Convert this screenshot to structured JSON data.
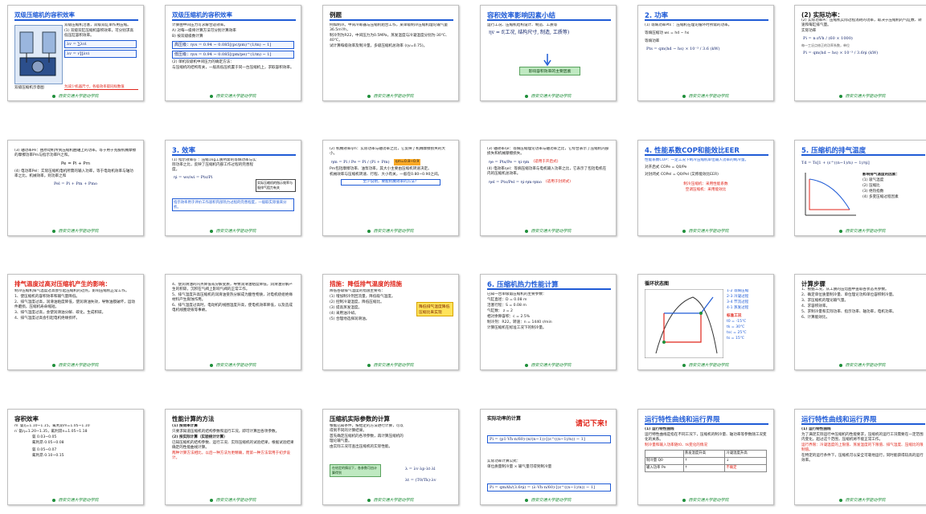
{
  "footer_text": "西安交通大学能动学院",
  "slides": [
    {
      "title": "双级压缩机的容积效率",
      "lines": [
        "双级压缩机活塞，双级双缸单作用压缩。",
        "(1) 双级双缸压缩机容积效率，可分别求高低压缸容积效率。",
        "双级压缩机示意图"
      ],
      "formula_a": "λv = ∑λvi",
      "formula_b": "λv = √∏λvi",
      "note": "为减少机器尺寸，各级效率取同样数值"
    },
    {
      "title": "双级压缩机的容积效率",
      "lines": [
        "计算由中间压力可求解合适效率。",
        "A) 对每一级将计算方法可分别计算效率",
        "B) 按双级级数计算"
      ],
      "formula_a": "高压级：ηvs = 0.94 − 0.085[(pc/pm)^(1/m) − 1]",
      "formula_b": "低压级：ηvs = 0.94 − 0.085[(pm/pe)^(1/m) − 1]",
      "lines2": [
        "(2) 单机双级机中间压力的确定方法：",
        "与压缩机的结构有关，一般高低压机置于同一台压缩机上，求取容积效率。"
      ]
    },
    {
      "title": "例题",
      "lines": [
        "例如制冷。中间冷却器与压缩机组合工作，某单级制冷压缩机理论输气量36.5m³/h，",
        "制冷剂为R22，中间压力为0.5MPa，蒸发温度与冷凝温度分别为-30℃、40℃，",
        "试计算每级效率及制冷量，多级压缩机总效率 (ηv=0.75)。"
      ]
    },
    {
      "title": "容积效率影响因素小结",
      "lines": [
        "运行工况、压缩机结构设计、制造、工质等"
      ],
      "formula_a": "ηv = f(工况, 结构尺寸, 制造, 工质等)",
      "note": "影响容积效率的主要因素"
    },
    {
      "title": "2. 功率",
      "lines": [
        "(1) 等熵功率Pts ：压缩机在理论循环时所需的功率。",
        "等熵压缩功 ws = hd − hs",
        "等熵功率"
      ],
      "formula_a": "Pts = qm(hd − hs) × 10⁻³ / 3.6  (kW)"
    },
    {
      "title": "(2) 实际功率：",
      "lines": [
        "(2) 实际功率Pi：压缩机实际过程消耗的功率，取决于压缩机的气缸数、转速和每缸排气量。",
        "实际功率",
        "每一工况点修正的功率系数，单位"
      ],
      "formula_a": "Pi = n·zVh / (60 × 1000)",
      "formula_b": "Pi = qm(hd − hs) × 10⁻³ / 3.6ηi  (kW)"
    },
    {
      "title": "(3) 轴功率",
      "lines": [
        "(3) 轴功率Pe：由原动机传到压缩机曲轴上的功率。等于用于克服机械摩擦的摩擦功率Pm与指示功率Pi之和。",
        "Pe = Pi + Pm",
        "(4) 电功率Pel：实际压缩机电机所需的输入功率，等于电动机效率与轴功率之比，机械效率，则功率之和"
      ],
      "formula_a": "Pel = Pi + Pm + Pmo"
    },
    {
      "title": "3. 效率",
      "lines": [
        "(1) 指示效率ηi ：压缩1kg工质所需的等熵功率与实际功率之比，反映了压缩机内部工作过程的完善程度。",
        "ηi = ws/wi = Pts/Pi",
        "指示效率用于评价工作容积内部热力过程的完善程度，一般取实际值来分析。"
      ],
      "note": "实际压缩机的指示效率与吸排气阻力有关"
    },
    {
      "title": "(2) 机械效率ηm：",
      "lines": [
        "(2) 机械效率ηm：实际功率与轴功率之比，它反映了机械摩擦损失的大小。"
      ],
      "formula_a": "ηm = Pi / Pe = Pi / (Pi + Pm)",
      "note": "ηm=0.8~0.9",
      "lines2": [
        "Pm包括摩擦功率、油泵功率，其大小主要由压缩机转速决定。",
        "机械效率与压缩机转速、行程、大小有关，一般在0.80~0.90之间。",
        "至少说明，要能机械效率的方法？"
      ]
    },
    {
      "title": "(3) 轴效率ηe：",
      "lines": [
        "(3) 轴效率ηe：等熵压缩理论功率与轴功率之比，它综合表示了压缩机内部损失和机械摩擦损失。"
      ],
      "formula_a": "ηe = Pts/Pe = ηi·ηm",
      "note": "(适用于开启式)",
      "lines2": [
        "(4) 电效率ηel：等熵压缩功率与电机输入功率之比，它表示了包括电机在内的压缩机总效率。"
      ],
      "formula_b": "ηel = Pts/Pel = ηi·ηm·ηmo",
      "note2": "(适用于封闭式)"
    },
    {
      "title": "4. 性能系数COP和能效比EER",
      "lines": [
        "性能系数COP：一定工况下制冷压缩机单位输入功率的制冷量。",
        "对开启式  COPe = Q0/Pe",
        "对封闭式  COPel = Q0/Pel   (又称能效比EER)"
      ],
      "note": "制冷压缩机：采用性能系数",
      "note2": "空调压缩机：采用能效比"
    },
    {
      "title": "5. 压缩机的排气温度",
      "lines": [
        "影响排气温度的因素：",
        "(1) 吸气温度",
        "(2) 压缩比",
        "(3) 绝热指数",
        "(4) 多变压缩过程因素"
      ],
      "formula_a": "Td = Ts[1 + (ε^((n−1)/n) − 1)/ηi]"
    },
    {
      "title": "排气温度过高对压缩机产生的影响：",
      "lines": [
        "制冷压缩机排气温度过高会引起压缩机的过热，影响压缩机正常工作。",
        "1、使压缩机的容积效率和输气量降低。",
        "2、排气温度过高，润滑油粘度降低，使润滑油失效，导致油膜破坏，运动件磨损，压缩机寿命缩短。",
        "3、排气温度过高，会使润滑油分解、碳化，生成积碳。",
        "4、排气温度过高会引起电机绝缘损坏。"
      ]
    },
    {
      "title": "排气温度过高的危害",
      "lines": [
        "4、使润滑油的闪点降低或分解变质，导致润滑油粘度降低，润滑油分解产生的积碳，沉积在气阀上影响气阀的正常工作。",
        "5、排气温度升高压缩机的润滑油受热分解成为酸性物质，对电机绕组绝缘材料产生腐蚀作用。",
        "6、排气温度过高时，电动机的线圈温度升高，使电机效率降低，以及造成电机线圈烧毁等事故。"
      ]
    },
    {
      "title": "措施：降低排气温度的措施",
      "lines": [
        "降低各级排气温度的措施主要有：",
        "(1) 增加制冷剂回流量，降低吸气温度。",
        "(2) 控制冷凝温度，降低压缩比。",
        "(3) 提高蒸发温度。",
        "(4) 采用油冷却。",
        "(5) 合理地选择润滑油。"
      ],
      "note": "降低排气温度降低压缩比来实现"
    },
    {
      "title": "6. 压缩机热力性能计算",
      "lines": [
        "已知一台单级氨压缩机的主要参数：",
        "气缸直径：D = 0.08 m",
        "活塞行程：S = 0.08 m",
        "气缸数：  z = 2",
        "相对余隙容积：c = 2.5%",
        "制冷剂：R22，转速：n = 1440 r/min",
        "计算压缩机在标准工况下的制冷量。"
      ]
    },
    {
      "title": "循环状态图",
      "lines": [
        "1-2 等熵压缩",
        "2-3 冷凝过程",
        "3-4 节流过程",
        "4-1 蒸发过程"
      ],
      "note": "标准工况",
      "lines2": [
        "t0 = -15℃",
        "tk = 30℃",
        "tsc = 25℃",
        "ts = 15℃"
      ]
    },
    {
      "title": "计算步骤",
      "lines": [
        "1、根据工况，从工质的压焓图中查取各状态点参数。",
        "2、确定单位质量制冷量、单位理论功和单位容积制冷量。",
        "3、求压缩机的理论输气量。",
        "4、求容积效率。",
        "5、求制冷量和实际功率、指示功率、轴功率，电机功率。",
        "6、计算能效比。"
      ]
    },
    {
      "title": "容积效率",
      "lines": [
        "m′ 氨η=1.10~1.15，氟利昂m=1.05~1.10",
        "n′ 氨η=1.20~1.35，氟利昂n=1.05~1.18",
        "氨 0.03~0.05",
        "氟利昂 0.05~0.08",
        "氨 0.05~0.07",
        "氟利昂 0.10~0.15"
      ]
    },
    {
      "title": "性能计算的方法",
      "lines": [
        "(1) 按效率计算",
        "只要求知道压缩机的结构参数和运行工况，即可计算出各项参数。",
        "(2) 按实际计算（实验统计计算）",
        "已知压缩机的结构参数、运行工况、实际压缩机的试验结果，根据试验结果确定的性能曲线计算。",
        "两种计算方法相比，以后一种方法为更精确，而第一种方法常用于初步设计。"
      ]
    },
    {
      "title": "压缩机实际参数的计算",
      "lines": [
        "根据已知条件，按给定的方法进行计算，可以得到不同的计算结果。",
        "首先确定压缩机的各项参数，再计算压缩机的理论输气量。",
        "由实际工况可查出压缩机的实际性能。"
      ],
      "formula_a": "λ = λv·λp·λt·λl",
      "formula_b": "λt = (T0/Tk)·λv",
      "note": "在给定的情况下，各参数可由计算得到"
    },
    {
      "title": "实际功率的计算",
      "title2": "请记下来!",
      "lines": [
        "实际功率计算公式：",
        "单位质量制冷量 × 输气量可得到制冷量"
      ],
      "formula_a": "Pi = (p1·Vh·n/60)·(n/(n−1))·[(ε^((n−1)/n)) − 1]",
      "formula_b": "Pi = qmΔh/(3.6ηi) = (λ·Vh·n/60)·[(ε^((n−1)/n)) − 1]"
    },
    {
      "title": "运行特性曲线和运行界限",
      "lines": [
        "(1) 运行特性曲线",
        "运行特性曲线是指在不同工况下，压缩机的制冷量、轴功率等参数随工况变化的关系。",
        "制冷量和输入功率随t0、tk变化的情况"
      ],
      "table": [
        [
          "",
          "蒸发温度升高",
          "冷凝温度升高"
        ],
        [
          "制冷量 Q0",
          "↑",
          "↓"
        ],
        [
          "输入功率 Pe",
          "↑",
          "不确定"
        ]
      ]
    },
    {
      "title": "运行特性曲线和运行界限",
      "lines": [
        "(1) 运行特性曲线",
        "为了满足实际运行中压缩机的性能要求，压缩机的运行工况需要在一定范围内变化，超过这个范围，压缩机将不能正常工作。",
        "运行界限：冷凝温度的上限值、蒸发温度的下限值、排气温度、压缩比的限制值。",
        "在特定的运行条件下，压缩机可以安全可靠地运行，同时能获得较高的运行效率。"
      ]
    }
  ]
}
